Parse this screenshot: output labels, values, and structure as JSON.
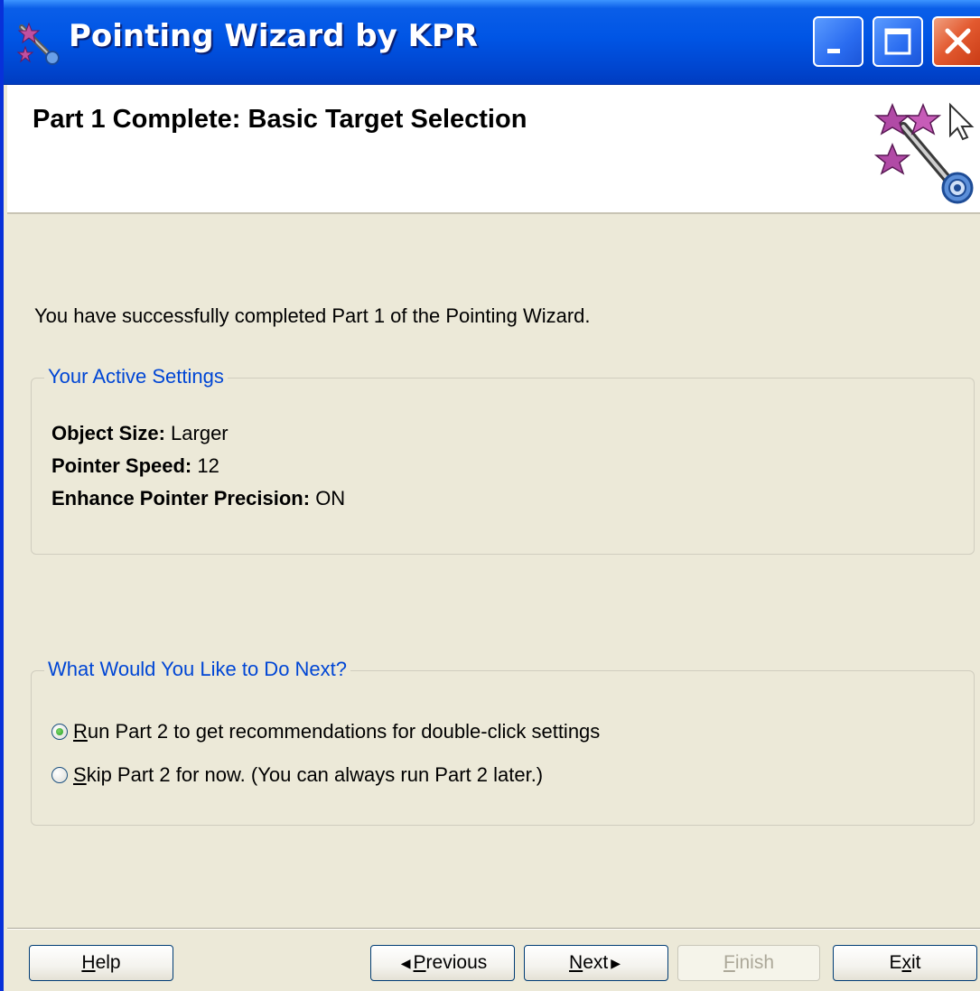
{
  "window": {
    "title": "Pointing Wizard by KPR",
    "controls": {
      "minimize": "minimize",
      "maximize": "maximize",
      "close": "close"
    }
  },
  "header": {
    "title": "Part 1 Complete: Basic Target Selection"
  },
  "intro": "You have successfully completed Part 1 of the Pointing Wizard.",
  "settings": {
    "legend": "Your Active Settings",
    "items": [
      {
        "label": "Object Size:",
        "value": " Larger"
      },
      {
        "label": "Pointer Speed:",
        "value": " 12"
      },
      {
        "label": "Enhance Pointer Precision:",
        "value": " ON"
      }
    ]
  },
  "next": {
    "legend": "What Would You Like to Do Next?",
    "options": [
      {
        "mnemonic": "R",
        "rest": "un Part 2 to get recommendations for double-click settings",
        "selected": true
      },
      {
        "mnemonic": "S",
        "rest": "kip Part 2 for now. (You can always run Part 2 later.)",
        "selected": false
      }
    ]
  },
  "buttons": {
    "help": {
      "mnemonic": "H",
      "rest": "elp"
    },
    "previous": {
      "mnemonic": "P",
      "rest": "revious"
    },
    "next": {
      "mnemonic": "N",
      "rest": "ext"
    },
    "finish": {
      "mnemonic": "F",
      "rest": "inish",
      "disabled": true
    },
    "exit": {
      "pre": "E",
      "mnemonic": "x",
      "rest": "it"
    }
  },
  "colors": {
    "titlebar": "#0055e5",
    "legend_text": "#0046d5",
    "dialog_bg": "#ece9d8"
  }
}
